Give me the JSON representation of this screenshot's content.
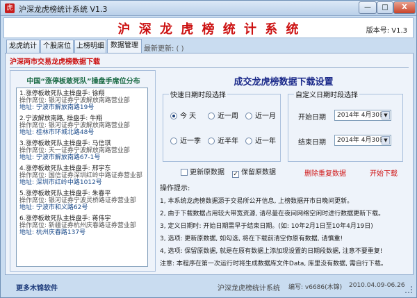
{
  "window": {
    "title": "沪深龙虎榜统计系统 V1.3",
    "app_icon": "虎",
    "minimize": "—",
    "maximize": "□",
    "close": "X"
  },
  "banner": {
    "title": "沪 深 龙 虎 榜 统 计 系 统",
    "version": "版本号: V1.3"
  },
  "tabs": [
    {
      "label": "龙虎统计"
    },
    {
      "label": "个股席位"
    },
    {
      "label": "上榜明细"
    },
    {
      "label": "数据管理",
      "active": true
    }
  ],
  "latest_update": "最新更新: ( )",
  "section_title": "沪深两市交易龙虎榜数据下载",
  "left_panel": {
    "title": "中国“涨停板敢死队”操盘手席位分布",
    "entries": [
      {
        "l1": "1.涨停板敢死队主操盘手: 徐翔",
        "l2": "操作席位: 银河证券宁波解放南路营业部",
        "l3": "地址: 宁波市解放南路19号"
      },
      {
        "l1": "2.宁波解放南路, 操盘手: 牛翔",
        "l2": "操作席位: 银河证券宁波解放南路营业部",
        "l3": "地址: 桂林市环城北路48号"
      },
      {
        "l1": "3.涨停板敢死队主操盘手: 马信琪",
        "l2": "操作席位: 天一证券宁波解放南路营业部",
        "l3": "地址: 宁波市解放南路67-1号"
      },
      {
        "l1": "4.涨停板敢死队主操盘手: 邢宇东",
        "l2": "操作席位: 国信证券深圳红岭中路证券营业部",
        "l3": "地址: 深圳市红岭中路1012号"
      },
      {
        "l1": "5.涨停板敢死队主操盘手: 朱春平",
        "l2": "操作席位: 银河证券宁波灵桥路证券营业部",
        "l3": "地址: 宁波市和义路62号"
      },
      {
        "l1": "6.涨停板敢死队主操盘手: 蒋伟宇",
        "l2": "操作席位: 新疆证券杭州庆春路证券营业部",
        "l3": "地址: 杭州庆春路137号"
      }
    ]
  },
  "download": {
    "title": "成交龙虎榜数据下载设置",
    "quick_group": "快速日期时段选择",
    "quick_options": [
      {
        "label": "今 天",
        "checked": true
      },
      {
        "label": "近一周",
        "checked": false
      },
      {
        "label": "近一月",
        "checked": false
      },
      {
        "label": "近一季",
        "checked": false
      },
      {
        "label": "近半年",
        "checked": false
      },
      {
        "label": "近一年",
        "checked": false
      }
    ],
    "custom_group": "自定义日期时段选择",
    "start_label": "开始日期",
    "start_value": "2014年 4月30日",
    "end_label": "结束日期",
    "end_value": "2014年 4月30日",
    "dropdown_glyph": "▼",
    "update_original": "更新原数据",
    "keep_original": "保留原数据",
    "check_glyph": "✓",
    "delete_redownload": "删除重复数据",
    "start_download": "开始下载"
  },
  "tips": {
    "head": "操作提示:",
    "items": [
      "1, 本系统龙虎榜数据源于交易所公开信息, 上榜数据开市日晚间更新。",
      "2, 由于下载数据占用较大带宽资源, 请尽量在夜间网络空闲时进行数据更新下载。",
      "3, 定义日期时: 开始日期需早于结束日期。(如: 10年2月1日至10年4月19日)",
      "3, 选项: 更新原数据, 如勾选, 将在下载前清空你原有数据, 请慎重!",
      "4, 选项: 保留原数据, 就是在原有数据上添加现设置的日期段数据, 注意不要重复!",
      "注意: 本程序在第一次运行时将生成数据库文件Data, 库里没有数据, 需自行下载。"
    ]
  },
  "status": {
    "more": "更多木锦软件",
    "app": "沪深龙虎榜统计系统",
    "author": "编写: v6686(木锦)",
    "date": "2010.04.09-06.26"
  }
}
